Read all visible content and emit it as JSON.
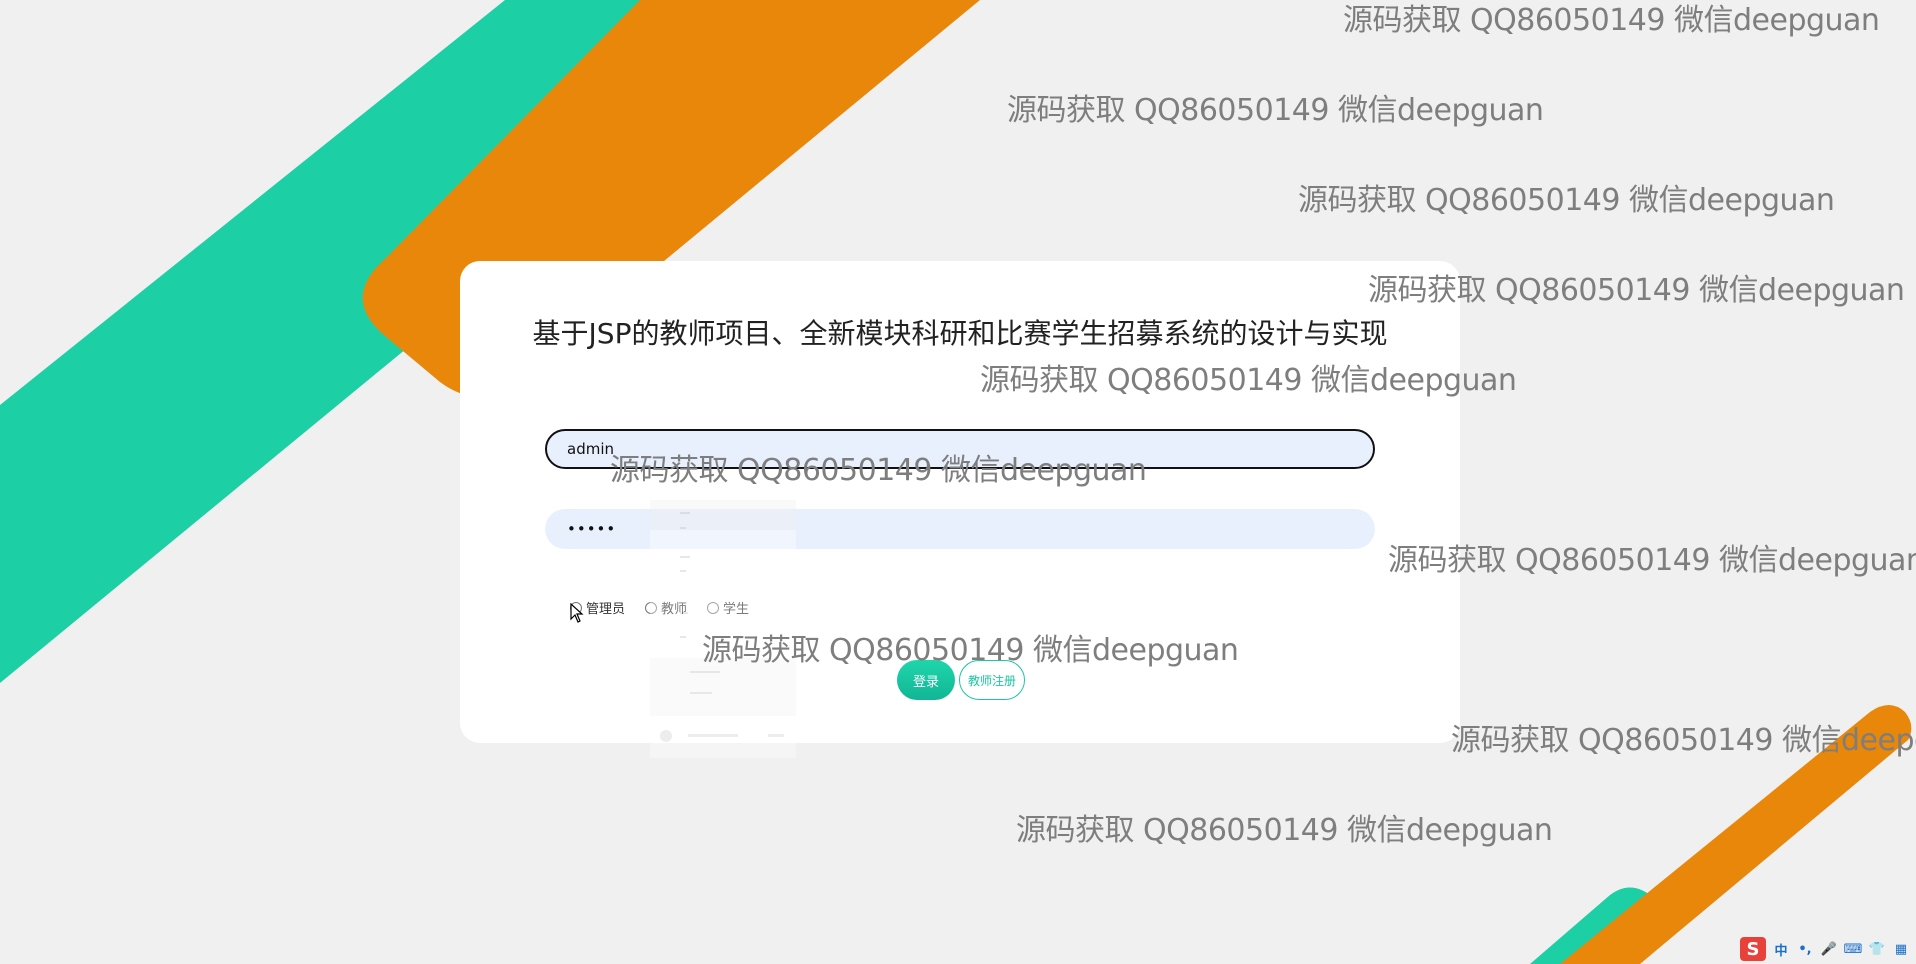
{
  "page": {
    "title": "基于JSP的教师项目、全新模块科研和比赛学生招募系统的设计与实现"
  },
  "login": {
    "username_value": "admin",
    "password_value": "•••••",
    "roles": [
      {
        "label": "管理员",
        "checked": false
      },
      {
        "label": "教师",
        "checked": false
      },
      {
        "label": "学生",
        "checked": false
      }
    ],
    "login_button": "登录",
    "register_button": "教师注册"
  },
  "watermark": {
    "text": "源码获取 QQ86050149 微信deepguan"
  },
  "taskbar": {
    "ime_logo": "S",
    "ime_mode": "中",
    "punct": "•,",
    "mic": "🎤",
    "keyboard": "⌨",
    "skin": "👕",
    "apps": "▦"
  },
  "colors": {
    "teal": "#1ccfa5",
    "orange": "#e8870a",
    "background": "#f0f0f0",
    "card": "#ffffff",
    "field": "#e8f0fe",
    "watermark": "#7e7e7e"
  }
}
